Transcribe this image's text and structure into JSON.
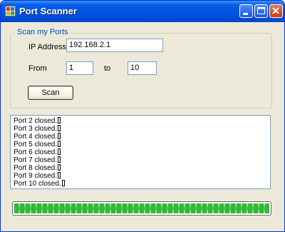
{
  "window": {
    "title": "Port Scanner",
    "controls": [
      "minimize-icon",
      "maximize-icon",
      "close-icon"
    ],
    "titlebar_color": "#0054e3"
  },
  "scan_group": {
    "legend": "Scan my Ports",
    "ip_label": "IP Address",
    "ip_value": "192.168.2.1",
    "from_label": "From",
    "from_value": "1",
    "to_label": "to",
    "to_value": "10",
    "scan_button": "Scan"
  },
  "results": [
    "Port 2 closed.",
    "Port 3 closed.",
    "Port 4 closed.",
    "Port 5 closed.",
    "Port 6 closed.",
    "Port 7 closed.",
    "Port 8 closed.",
    "Port 9 closed.",
    "Port 10 closed."
  ],
  "progress": {
    "fraction": 1.0,
    "color": "#33b83a"
  }
}
